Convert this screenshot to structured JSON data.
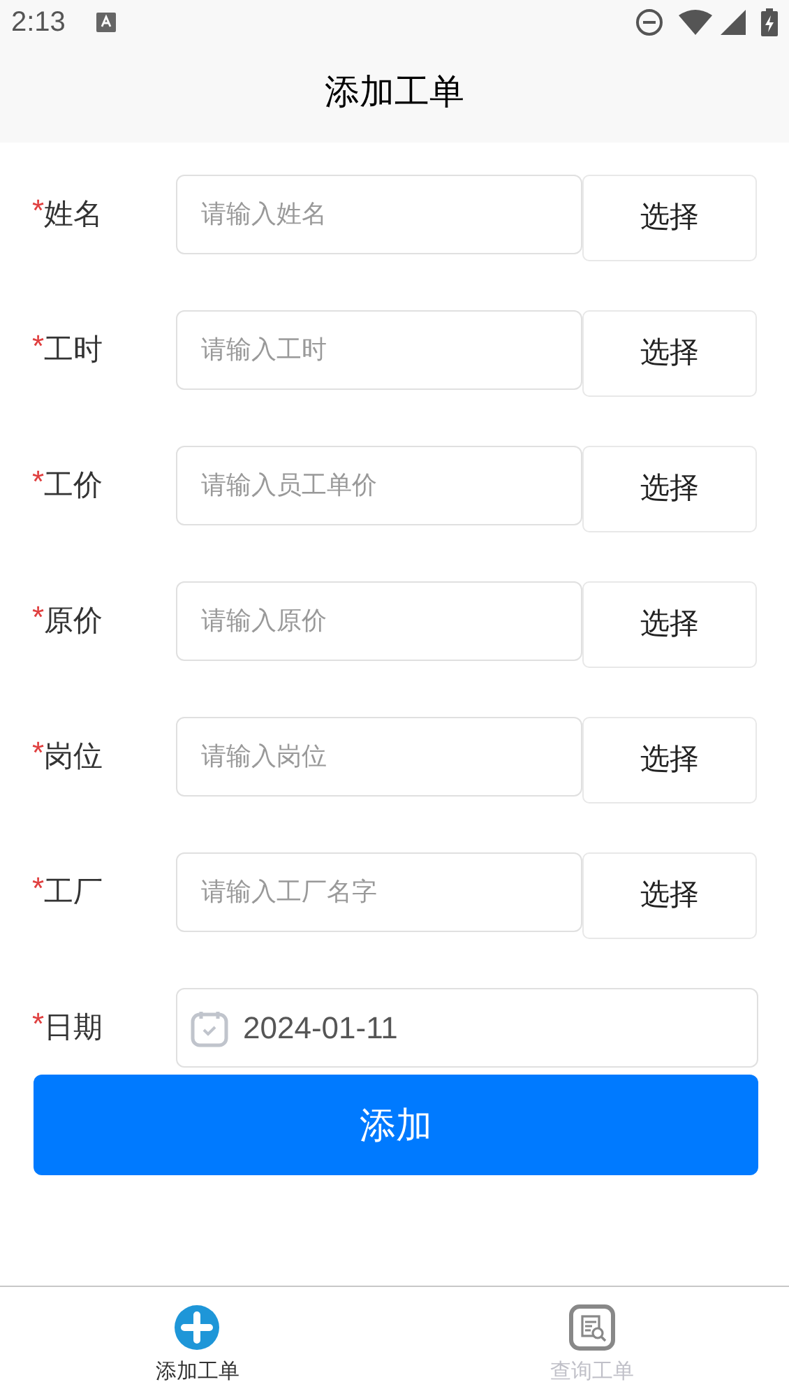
{
  "status_bar": {
    "time": "2:13"
  },
  "header": {
    "title": "添加工单"
  },
  "fields": [
    {
      "kind": "select",
      "label": "姓名",
      "required": true,
      "placeholder": "请输入姓名",
      "button": "选择"
    },
    {
      "kind": "select",
      "label": "工时",
      "required": true,
      "placeholder": "请输入工时",
      "button": "选择"
    },
    {
      "kind": "select",
      "label": "工价",
      "required": true,
      "placeholder": "请输入员工单价",
      "button": "选择"
    },
    {
      "kind": "select",
      "label": "原价",
      "required": true,
      "placeholder": "请输入原价",
      "button": "选择"
    },
    {
      "kind": "select",
      "label": "岗位",
      "required": true,
      "placeholder": "请输入岗位",
      "button": "选择"
    },
    {
      "kind": "select",
      "label": "工厂",
      "required": true,
      "placeholder": "请输入工厂名字",
      "button": "选择"
    },
    {
      "kind": "date",
      "label": "日期",
      "required": true,
      "value": "2024-01-11"
    }
  ],
  "submit": "添加",
  "required_mark": "*",
  "tabs": [
    {
      "kind": "add",
      "label": "添加工单",
      "selected": true
    },
    {
      "kind": "query",
      "label": "查询工单",
      "selected": false
    }
  ]
}
